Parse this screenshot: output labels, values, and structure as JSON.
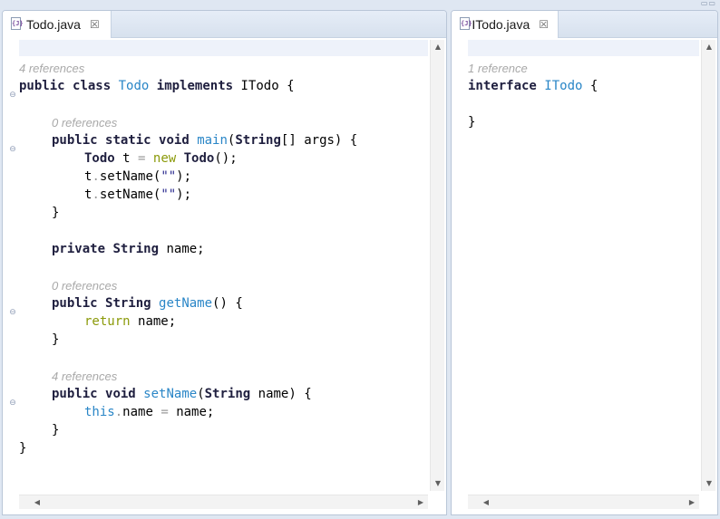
{
  "window": {
    "controls": "▭▭"
  },
  "left_editor": {
    "tab": {
      "label": "Todo.java",
      "icon": "java-file-icon",
      "close": "☒"
    },
    "lenses": [
      "4 references",
      "0 references",
      "0 references",
      "4 references"
    ],
    "code": {
      "l1_kw1": "public",
      "l1_kw2": "class",
      "l1_ty": "Todo",
      "l1_kw3": "implements",
      "l1_rest": "ITodo {",
      "l2_kw1": "public",
      "l2_kw2": "static",
      "l2_kw3": "void",
      "l2_ty": "main",
      "l2_p1": "(",
      "l2_kw4": "String",
      "l2_rest": "[] args) {",
      "l3_kw1": "Todo",
      "l3_id": " t ",
      "l3_op": "=",
      "l3_nw": "new",
      "l3_kw2": "Todo",
      "l3_rest": "();",
      "l4_id": "t",
      "l4_op": ".",
      "l4_fn": "setName(",
      "l4_str": "\"\"",
      "l4_rest": ");",
      "l5_id": "t",
      "l5_op": ".",
      "l5_fn": "setName(",
      "l5_str": "\"\"",
      "l5_rest": ");",
      "l6": "}",
      "l7_kw1": "private",
      "l7_kw2": "String",
      "l7_rest": "name;",
      "l8_kw1": "public",
      "l8_kw2": "String",
      "l8_ty": "getName",
      "l8_rest": "() {",
      "l9_ret": "return",
      "l9_rest": "name;",
      "l10": "}",
      "l11_kw1": "public",
      "l11_kw2": "void",
      "l11_ty": "setName",
      "l11_p1": "(",
      "l11_kw3": "String",
      "l11_rest": "name) {",
      "l12_this": "this",
      "l12_op1": ".",
      "l12_mid": "name ",
      "l12_op2": "=",
      "l12_rest": "name;",
      "l13": "}",
      "l14": "}"
    },
    "fold_markers": [
      "⊖",
      "⊖",
      "⊖",
      "⊖"
    ]
  },
  "right_editor": {
    "tab": {
      "label": "ITodo.java",
      "icon": "java-file-icon",
      "close": "☒"
    },
    "lenses": [
      "1 reference"
    ],
    "code": {
      "l1_kw": "interface",
      "l1_ty": "ITodo",
      "l1_rest": "{",
      "l2": "}"
    }
  },
  "scroll_arrows": {
    "up": "▲",
    "down": "▼",
    "left": "◀",
    "right": "▶"
  }
}
